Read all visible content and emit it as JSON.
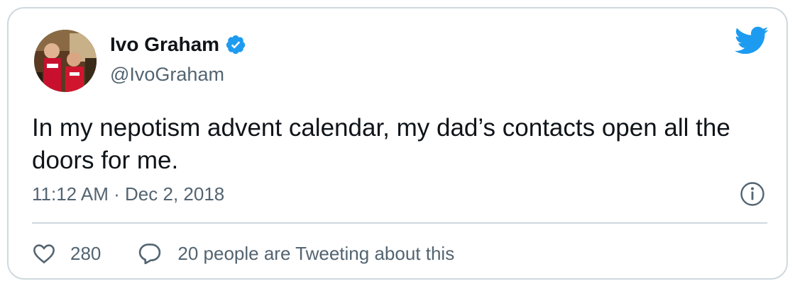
{
  "user": {
    "display_name": "Ivo Graham",
    "handle": "@IvoGraham",
    "verified": true
  },
  "tweet": {
    "text": "In my nepotism advent calendar, my dad’s contacts open all the doors for me.",
    "timestamp": "11:12 AM · Dec 2, 2018"
  },
  "actions": {
    "like_count": "280",
    "reply_text": "20 people are Tweeting about this"
  },
  "colors": {
    "brand": "#1d9bf0",
    "text_primary": "#0f1419",
    "text_secondary": "#536471",
    "border": "#cfd9de"
  },
  "icons": {
    "verified": "verified-badge-icon",
    "brand": "twitter-bird-icon",
    "info": "info-icon",
    "like": "heart-icon",
    "reply": "speech-bubble-icon"
  }
}
